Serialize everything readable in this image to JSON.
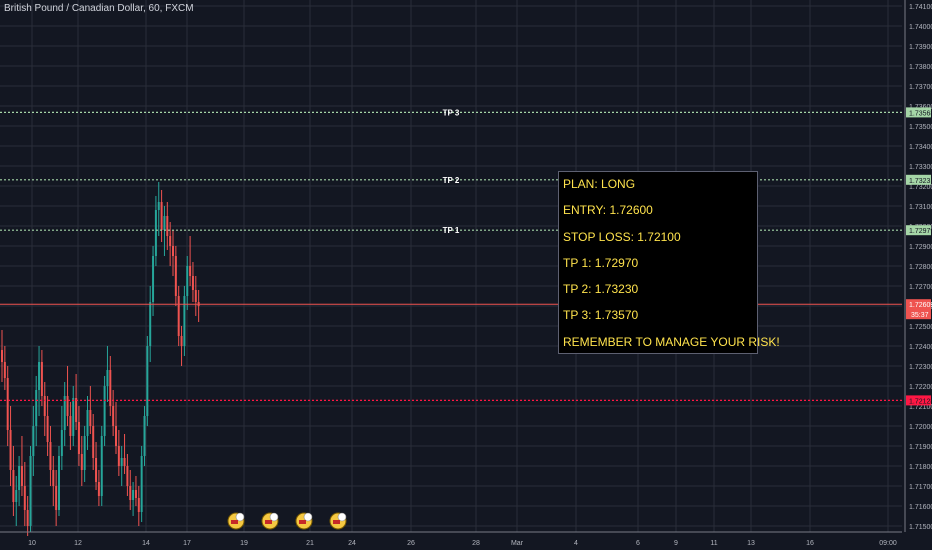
{
  "title": "British Pound / Canadian Dollar, 60, FXCM",
  "colors": {
    "background": "#131722",
    "up": "#26a69a",
    "down": "#ef5350",
    "grid": "#2a2e39",
    "tp": "#a5d6a7",
    "stop": "#ff1744",
    "current": "#ef5350",
    "plan_text": "#ffe34d"
  },
  "chart_data": {
    "type": "candlestick",
    "title": "British Pound / Canadian Dollar, 60, FXCM",
    "y_ticks": [
      "1.74100",
      "1.74000",
      "1.73900",
      "1.73800",
      "1.73700",
      "1.73600",
      "1.73500",
      "1.73400",
      "1.73300",
      "1.73200",
      "1.73100",
      "1.73000",
      "1.72900",
      "1.72800",
      "1.72700",
      "1.72600",
      "1.72500",
      "1.72400",
      "1.72300",
      "1.72200",
      "1.72100",
      "1.72000",
      "1.71900",
      "1.71800",
      "1.71700",
      "1.71600",
      "1.71500"
    ],
    "ylim": [
      1.7147,
      1.7413
    ],
    "x_ticks": [
      "10",
      "12",
      "14",
      "17",
      "19",
      "21",
      "24",
      "26",
      "28",
      "Mar",
      "4",
      "6",
      "9",
      "11",
      "13",
      "16",
      "09:00"
    ],
    "grid": true,
    "horizontal_lines": [
      {
        "label": "TP 3",
        "value": 1.73568,
        "price_label": "1.73568",
        "style": "dotted",
        "color": "#a5d6a7"
      },
      {
        "label": "TP 2",
        "value": 1.73231,
        "price_label": "1.73231",
        "style": "dotted",
        "color": "#a5d6a7"
      },
      {
        "label": "TP 1",
        "value": 1.72979,
        "price_label": "1.72979",
        "style": "dotted",
        "color": "#a5d6a7"
      },
      {
        "label": "",
        "value": 1.72128,
        "price_label": "1.72128",
        "style": "dotted",
        "color": "#ff1744"
      }
    ],
    "current_price": {
      "value": 1.72609,
      "label": "1.72609",
      "countdown": "35:37"
    },
    "events_count": 4,
    "candles": [
      [
        1.7238,
        1.7248,
        1.7222,
        1.7232
      ],
      [
        1.7232,
        1.724,
        1.7218,
        1.7224
      ],
      [
        1.7224,
        1.723,
        1.719,
        1.7198
      ],
      [
        1.7198,
        1.721,
        1.717,
        1.7178
      ],
      [
        1.7178,
        1.719,
        1.7155,
        1.7162
      ],
      [
        1.7162,
        1.7175,
        1.715,
        1.7168
      ],
      [
        1.7168,
        1.7185,
        1.716,
        1.718
      ],
      [
        1.718,
        1.7195,
        1.7165,
        1.717
      ],
      [
        1.717,
        1.7182,
        1.715,
        1.7158
      ],
      [
        1.7158,
        1.7165,
        1.7145,
        1.715
      ],
      [
        1.715,
        1.719,
        1.7147,
        1.7185
      ],
      [
        1.7185,
        1.721,
        1.7175,
        1.72
      ],
      [
        1.72,
        1.7225,
        1.719,
        1.7218
      ],
      [
        1.7218,
        1.724,
        1.7205,
        1.7232
      ],
      [
        1.7232,
        1.7238,
        1.721,
        1.7215
      ],
      [
        1.7215,
        1.7222,
        1.7195,
        1.7205
      ],
      [
        1.7205,
        1.7215,
        1.7185,
        1.7192
      ],
      [
        1.7192,
        1.72,
        1.717,
        1.7178
      ],
      [
        1.7178,
        1.7185,
        1.716,
        1.717
      ],
      [
        1.717,
        1.7178,
        1.715,
        1.7158
      ],
      [
        1.7158,
        1.719,
        1.7155,
        1.7185
      ],
      [
        1.7185,
        1.721,
        1.7178,
        1.7198
      ],
      [
        1.7198,
        1.7222,
        1.719,
        1.7215
      ],
      [
        1.7215,
        1.723,
        1.72,
        1.7205
      ],
      [
        1.7205,
        1.7212,
        1.7188,
        1.7195
      ],
      [
        1.7195,
        1.722,
        1.719,
        1.7214
      ],
      [
        1.7214,
        1.7226,
        1.7198,
        1.7202
      ],
      [
        1.7202,
        1.721,
        1.718,
        1.7186
      ],
      [
        1.7186,
        1.7195,
        1.717,
        1.7178
      ],
      [
        1.7178,
        1.72,
        1.7172,
        1.7195
      ],
      [
        1.7195,
        1.7215,
        1.7188,
        1.7208
      ],
      [
        1.7208,
        1.722,
        1.7196,
        1.72
      ],
      [
        1.72,
        1.7206,
        1.7178,
        1.7184
      ],
      [
        1.7184,
        1.7192,
        1.7168,
        1.7172
      ],
      [
        1.7172,
        1.7178,
        1.716,
        1.7165
      ],
      [
        1.7165,
        1.72,
        1.716,
        1.7195
      ],
      [
        1.7195,
        1.7225,
        1.719,
        1.722
      ],
      [
        1.722,
        1.724,
        1.7212,
        1.7228
      ],
      [
        1.7228,
        1.7235,
        1.7205,
        1.721
      ],
      [
        1.721,
        1.7218,
        1.7195,
        1.72
      ],
      [
        1.72,
        1.7212,
        1.7186,
        1.719
      ],
      [
        1.719,
        1.7198,
        1.7175,
        1.718
      ],
      [
        1.718,
        1.719,
        1.717,
        1.7184
      ],
      [
        1.7184,
        1.7196,
        1.7176,
        1.718
      ],
      [
        1.718,
        1.7186,
        1.7165,
        1.717
      ],
      [
        1.717,
        1.7178,
        1.7158,
        1.7163
      ],
      [
        1.7163,
        1.7172,
        1.7155,
        1.7168
      ],
      [
        1.7168,
        1.7175,
        1.716,
        1.7164
      ],
      [
        1.7164,
        1.717,
        1.715,
        1.7157
      ],
      [
        1.7157,
        1.719,
        1.7152,
        1.7185
      ],
      [
        1.7185,
        1.721,
        1.718,
        1.7205
      ],
      [
        1.7205,
        1.7245,
        1.72,
        1.724
      ],
      [
        1.724,
        1.727,
        1.7232,
        1.7262
      ],
      [
        1.7262,
        1.729,
        1.7255,
        1.7285
      ],
      [
        1.7285,
        1.7315,
        1.728,
        1.7308
      ],
      [
        1.7308,
        1.7322,
        1.7295,
        1.7312
      ],
      [
        1.7312,
        1.7318,
        1.7292,
        1.7298
      ],
      [
        1.7298,
        1.731,
        1.7285,
        1.7305
      ],
      [
        1.7305,
        1.7312,
        1.7288,
        1.7295
      ],
      [
        1.7295,
        1.7302,
        1.728,
        1.729
      ],
      [
        1.729,
        1.7298,
        1.7275,
        1.7285
      ],
      [
        1.7285,
        1.729,
        1.726,
        1.7265
      ],
      [
        1.7265,
        1.727,
        1.724,
        1.7245
      ],
      [
        1.7245,
        1.725,
        1.723,
        1.724
      ],
      [
        1.724,
        1.727,
        1.7235,
        1.7265
      ],
      [
        1.7265,
        1.7285,
        1.7258,
        1.728
      ],
      [
        1.728,
        1.7295,
        1.727,
        1.7275
      ],
      [
        1.7275,
        1.7282,
        1.7262,
        1.7268
      ],
      [
        1.7268,
        1.7275,
        1.7255,
        1.7262
      ],
      [
        1.7262,
        1.7268,
        1.7252,
        1.726
      ]
    ]
  },
  "plan": {
    "line1": "PLAN: LONG",
    "line2": "ENTRY: 1.72600",
    "line3": "STOP LOSS: 1.72100",
    "line4": "TP 1: 1.72970",
    "line5": "TP 2: 1.73230",
    "line6": "TP 3: 1.73570",
    "line7": "REMEMBER TO MANAGE YOUR RISK!"
  }
}
